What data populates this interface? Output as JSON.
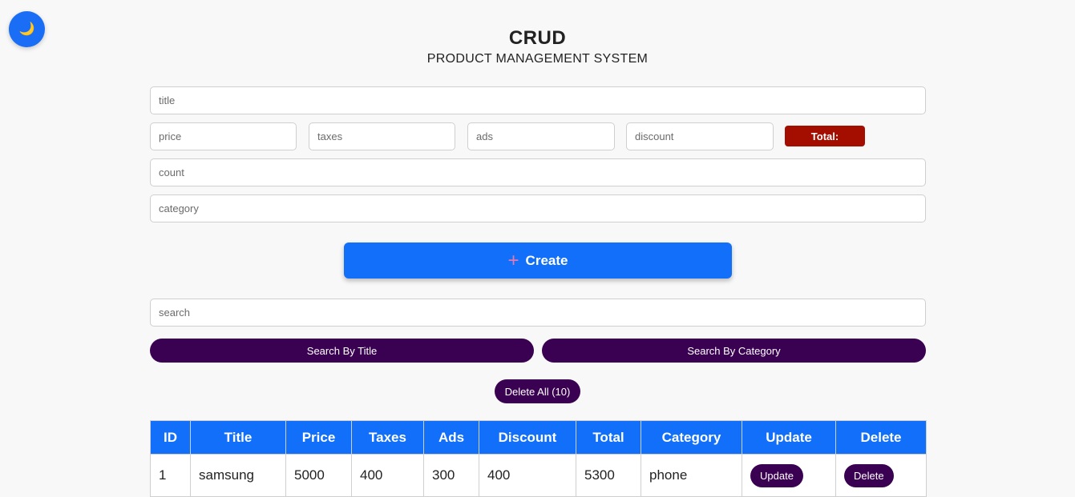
{
  "theme_toggle": {
    "icon": "moon-icon",
    "glyph": "🌙"
  },
  "header": {
    "title": "CRUD",
    "subtitle": "PRODUCT MANAGEMENT SYSTEM"
  },
  "form": {
    "title_placeholder": "title",
    "price_placeholder": "price",
    "taxes_placeholder": "taxes",
    "ads_placeholder": "ads",
    "discount_placeholder": "discount",
    "total_label": "Total:",
    "count_placeholder": "count",
    "category_placeholder": "category",
    "create_label": "Create",
    "create_icon": "plus-icon",
    "plus_glyph": "+"
  },
  "search": {
    "placeholder": "search",
    "by_title_label": "Search By Title",
    "by_category_label": "Search By Category"
  },
  "delete_all_label": "Delete All (10)",
  "colors": {
    "accent": "#126ff9",
    "total_bg": "#a30e00",
    "pill_bg": "#3a0052",
    "background": "#f8f8f8"
  },
  "table": {
    "headers": [
      "ID",
      "Title",
      "Price",
      "Taxes",
      "Ads",
      "Discount",
      "Total",
      "Category",
      "Update",
      "Delete"
    ],
    "rows": [
      {
        "id": "1",
        "title": "samsung",
        "price": "5000",
        "taxes": "400",
        "ads": "300",
        "discount": "400",
        "total": "5300",
        "category": "phone",
        "update_label": "Update",
        "delete_label": "Delete"
      }
    ]
  }
}
